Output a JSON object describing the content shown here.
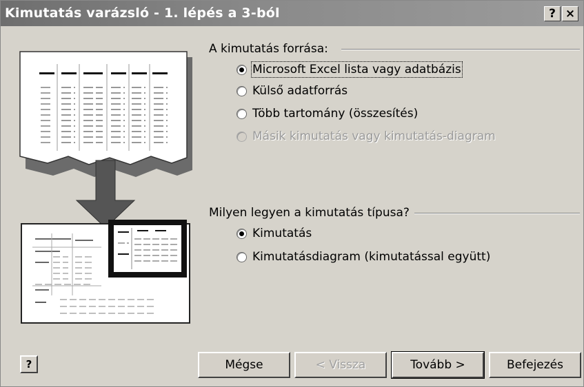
{
  "window": {
    "title": "Kimutatás varázsló - 1. lépés a 3-ból",
    "help_button": "?",
    "close_button": "×"
  },
  "source_group": {
    "label": "A kimutatás forrása:",
    "options": [
      {
        "label": "Microsoft Excel lista vagy adatbázis",
        "checked": true,
        "disabled": false
      },
      {
        "label": "Külső adatforrás",
        "checked": false,
        "disabled": false
      },
      {
        "label": "Több tartomány (összesítés)",
        "checked": false,
        "disabled": false
      },
      {
        "label": "Másik kimutatás vagy kimutatás-diagram",
        "checked": false,
        "disabled": true
      }
    ]
  },
  "type_group": {
    "label": "Milyen legyen a kimutatás típusa?",
    "options": [
      {
        "label": "Kimutatás",
        "checked": true
      },
      {
        "label": "Kimutatásdiagram (kimutatással együtt)",
        "checked": false
      }
    ]
  },
  "footer": {
    "help_icon": "?",
    "cancel": "Mégse",
    "back": "< Vissza",
    "next": "Tovább >",
    "finish": "Befejezés"
  }
}
